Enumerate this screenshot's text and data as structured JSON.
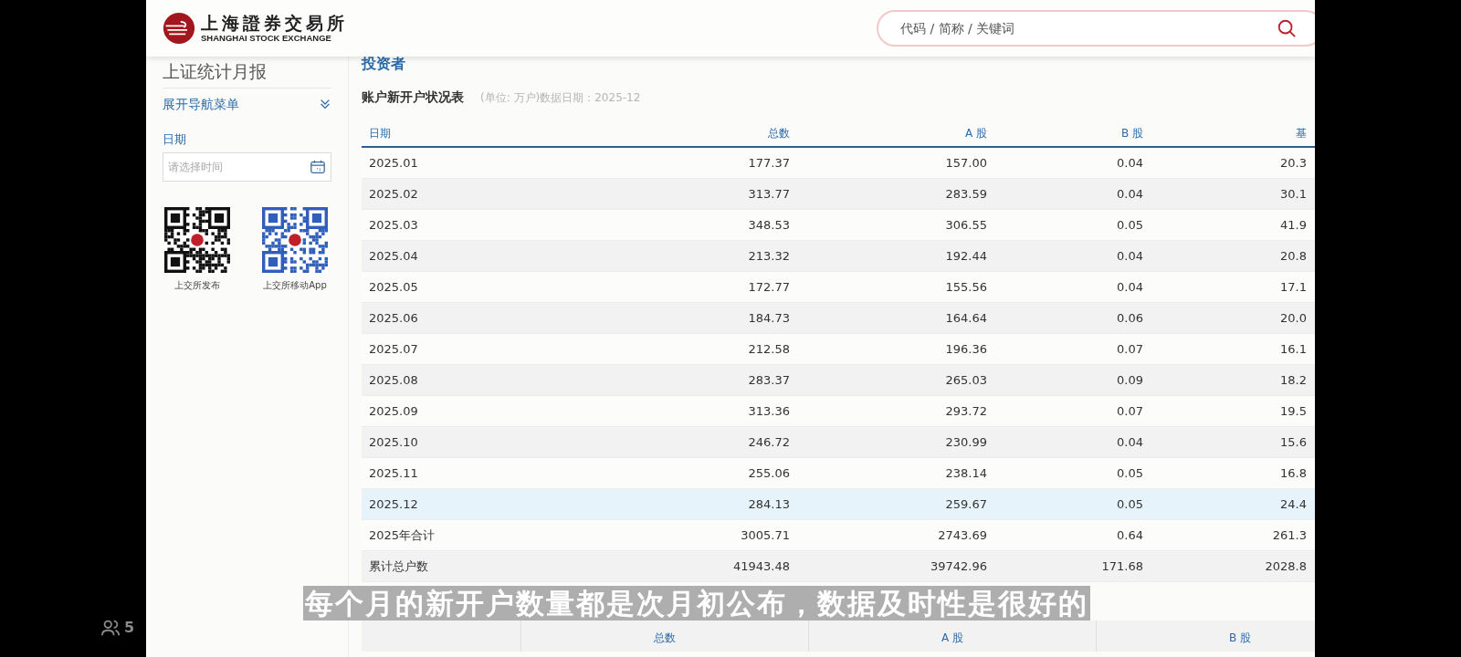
{
  "header": {
    "logo": {
      "name_cn": "上海證券交易所",
      "name_en": "SHANGHAI STOCK EXCHANGE"
    },
    "search": {
      "placeholder": "代码 / 简称 / 关键词"
    }
  },
  "sidebar": {
    "title": "上证统计月报",
    "nav_toggle": {
      "label": "展开导航菜单",
      "expanded": false
    },
    "date_filter": {
      "label": "日期",
      "placeholder": "请选择时间"
    },
    "qr_codes": [
      {
        "caption": "上交所发布",
        "kind": "plain"
      },
      {
        "caption": "上交所移动App",
        "kind": "app"
      }
    ]
  },
  "section_title": "投资者",
  "table": {
    "title": "账户新开户状况表",
    "meta": "(单位: 万户)数据日期：2025-12",
    "columns": [
      "日期",
      "总数",
      "A 股",
      "B 股",
      "基"
    ],
    "rows": [
      {
        "cells": [
          "2025.01",
          "177.37",
          "157.00",
          "0.04",
          "20.3"
        ],
        "selected": false
      },
      {
        "cells": [
          "2025.02",
          "313.77",
          "283.59",
          "0.04",
          "30.1"
        ],
        "selected": false
      },
      {
        "cells": [
          "2025.03",
          "348.53",
          "306.55",
          "0.05",
          "41.9"
        ],
        "selected": false
      },
      {
        "cells": [
          "2025.04",
          "213.32",
          "192.44",
          "0.04",
          "20.8"
        ],
        "selected": false
      },
      {
        "cells": [
          "2025.05",
          "172.77",
          "155.56",
          "0.04",
          "17.1"
        ],
        "selected": false
      },
      {
        "cells": [
          "2025.06",
          "184.73",
          "164.64",
          "0.06",
          "20.0"
        ],
        "selected": false
      },
      {
        "cells": [
          "2025.07",
          "212.58",
          "196.36",
          "0.07",
          "16.1"
        ],
        "selected": false
      },
      {
        "cells": [
          "2025.08",
          "283.37",
          "265.03",
          "0.09",
          "18.2"
        ],
        "selected": false
      },
      {
        "cells": [
          "2025.09",
          "313.36",
          "293.72",
          "0.07",
          "19.5"
        ],
        "selected": false
      },
      {
        "cells": [
          "2025.10",
          "246.72",
          "230.99",
          "0.04",
          "15.6"
        ],
        "selected": false
      },
      {
        "cells": [
          "2025.11",
          "255.06",
          "238.14",
          "0.05",
          "16.8"
        ],
        "selected": false
      },
      {
        "cells": [
          "2025.12",
          "284.13",
          "259.67",
          "0.05",
          "24.4"
        ],
        "selected": true
      },
      {
        "cells": [
          "2025年合计",
          "3005.71",
          "2743.69",
          "0.64",
          "261.3"
        ],
        "selected": false
      },
      {
        "cells": [
          "累计总户数",
          "41943.48",
          "39742.96",
          "171.68",
          "2028.8"
        ],
        "selected": false
      }
    ]
  },
  "table_2": {
    "columns": [
      "总数",
      "A 股",
      "B 股"
    ]
  },
  "subtitle": "每个月的新开户数量都是次月初公布，数据及时性是很好的",
  "viewer": {
    "count": "5"
  }
}
